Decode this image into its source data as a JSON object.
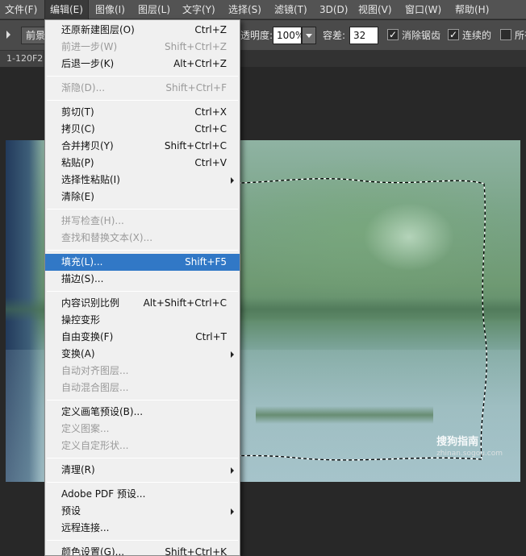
{
  "menubar": {
    "items": [
      "文件(F)",
      "编辑(E)",
      "图像(I)",
      "图层(L)",
      "文字(Y)",
      "选择(S)",
      "滤镜(T)",
      "3D(D)",
      "视图(V)",
      "窗口(W)",
      "帮助(H)"
    ]
  },
  "options": {
    "preset_label": "前景",
    "opacity_label": "透明度:",
    "opacity_value": "100%",
    "tolerance_label": "容差:",
    "tolerance_value": "32",
    "antialias_label": "消除锯齿",
    "contiguous_label": "连续的",
    "all_layers_label": "所有"
  },
  "document": {
    "tab_title": "1-120F2"
  },
  "watermark": {
    "brand": "搜狗指南",
    "url": "zhinan.sogou.com"
  },
  "edit_menu": {
    "items": [
      {
        "label": "还原新建图层(O)",
        "shortcut": "Ctrl+Z",
        "disabled": false
      },
      {
        "label": "前进一步(W)",
        "shortcut": "Shift+Ctrl+Z",
        "disabled": true
      },
      {
        "label": "后退一步(K)",
        "shortcut": "Alt+Ctrl+Z",
        "disabled": false
      },
      {
        "label": "渐隐(D)...",
        "shortcut": "Shift+Ctrl+F",
        "disabled": true
      },
      {
        "label": "剪切(T)",
        "shortcut": "Ctrl+X",
        "disabled": false
      },
      {
        "label": "拷贝(C)",
        "shortcut": "Ctrl+C",
        "disabled": false
      },
      {
        "label": "合并拷贝(Y)",
        "shortcut": "Shift+Ctrl+C",
        "disabled": false
      },
      {
        "label": "粘贴(P)",
        "shortcut": "Ctrl+V",
        "disabled": false
      },
      {
        "label": "选择性粘贴(I)",
        "shortcut": "",
        "disabled": false,
        "submenu": true
      },
      {
        "label": "清除(E)",
        "shortcut": "",
        "disabled": false
      },
      {
        "label": "拼写检查(H)...",
        "shortcut": "",
        "disabled": true
      },
      {
        "label": "查找和替换文本(X)...",
        "shortcut": "",
        "disabled": true
      },
      {
        "label": "填充(L)...",
        "shortcut": "Shift+F5",
        "disabled": false,
        "highlight": true
      },
      {
        "label": "描边(S)...",
        "shortcut": "",
        "disabled": false
      },
      {
        "label": "内容识别比例",
        "shortcut": "Alt+Shift+Ctrl+C",
        "disabled": false
      },
      {
        "label": "操控变形",
        "shortcut": "",
        "disabled": false
      },
      {
        "label": "自由变换(F)",
        "shortcut": "Ctrl+T",
        "disabled": false
      },
      {
        "label": "变换(A)",
        "shortcut": "",
        "disabled": false,
        "submenu": true
      },
      {
        "label": "自动对齐图层...",
        "shortcut": "",
        "disabled": true
      },
      {
        "label": "自动混合图层...",
        "shortcut": "",
        "disabled": true
      },
      {
        "label": "定义画笔预设(B)...",
        "shortcut": "",
        "disabled": false
      },
      {
        "label": "定义图案...",
        "shortcut": "",
        "disabled": true
      },
      {
        "label": "定义自定形状...",
        "shortcut": "",
        "disabled": true
      },
      {
        "label": "清理(R)",
        "shortcut": "",
        "disabled": false,
        "submenu": true
      },
      {
        "label": "Adobe PDF 预设...",
        "shortcut": "",
        "disabled": false
      },
      {
        "label": "预设",
        "shortcut": "",
        "disabled": false,
        "submenu": true
      },
      {
        "label": "远程连接...",
        "shortcut": "",
        "disabled": false
      },
      {
        "label": "颜色设置(G)...",
        "shortcut": "Shift+Ctrl+K",
        "disabled": false
      }
    ]
  }
}
